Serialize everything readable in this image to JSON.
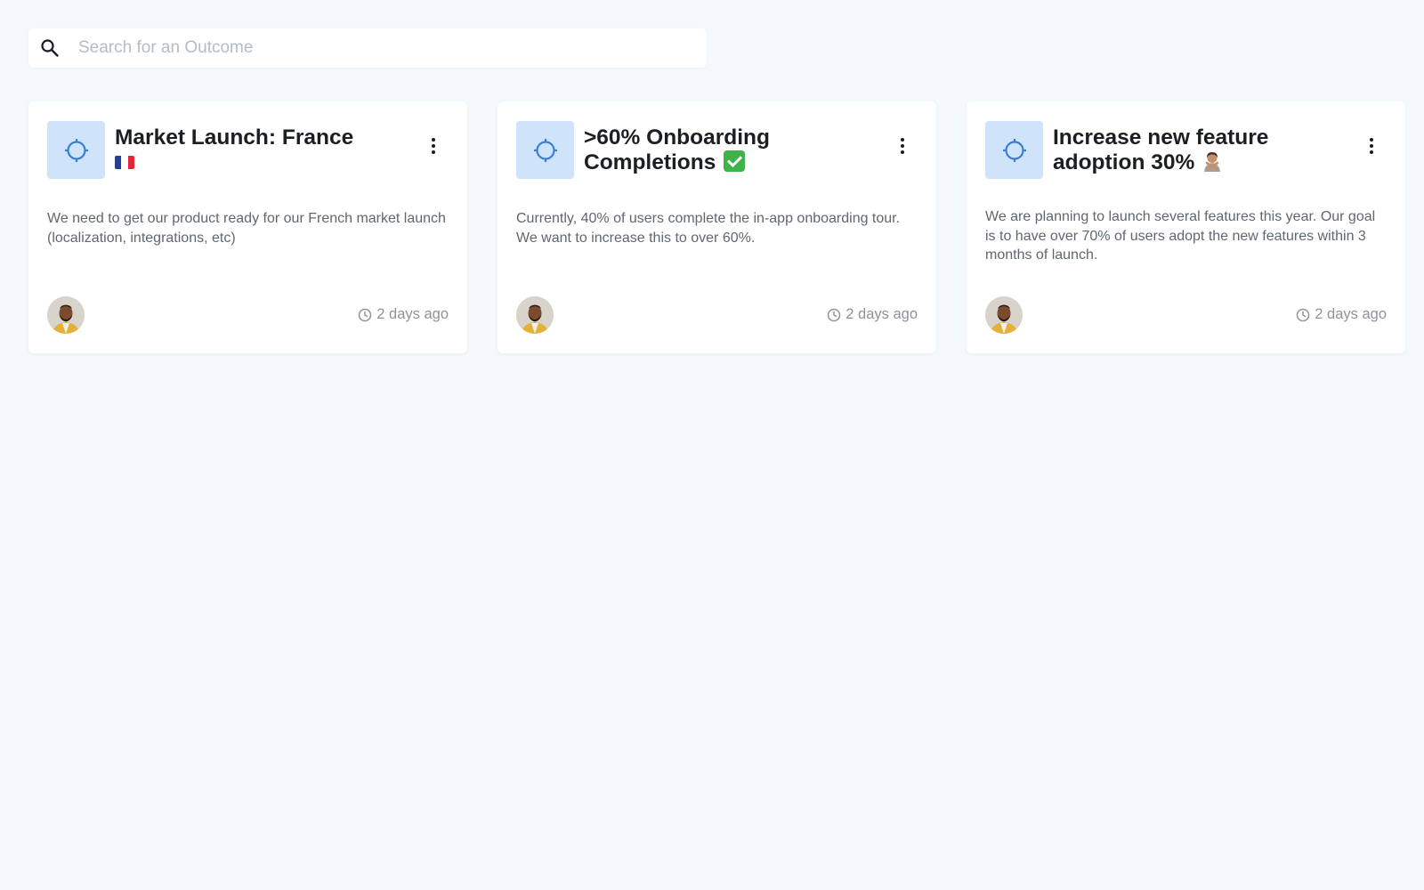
{
  "search": {
    "placeholder": "Search for an Outcome",
    "value": "",
    "icon": "search-icon"
  },
  "colors": {
    "page_bg": "#f4f9fc",
    "card_bg": "#ffffff",
    "icon_tile": "#cfe4fb",
    "icon_stroke": "#3b7fd4",
    "muted_text": "#8b939b"
  },
  "outcomes": [
    {
      "title": "Market Launch: France",
      "title_emoji": "french-flag",
      "description": "We need to get our product ready for our French market launch (localization, integrations, etc)",
      "timestamp": "2 days ago",
      "icon": "target-icon"
    },
    {
      "title": ">60% Onboarding Completions",
      "title_emoji": "check-mark-button",
      "description": "Currently, 40% of users complete the in-app onboarding tour. We want to increase this to over 60%.",
      "timestamp": "2 days ago",
      "icon": "target-icon"
    },
    {
      "title": "Increase new feature adoption 30%",
      "title_emoji": "person-gesturing-no",
      "description": "We are planning to launch several features this year. Our goal is to have over 70% of users adopt the new features within 3 months of launch.",
      "timestamp": "2 days ago",
      "icon": "target-icon"
    }
  ]
}
